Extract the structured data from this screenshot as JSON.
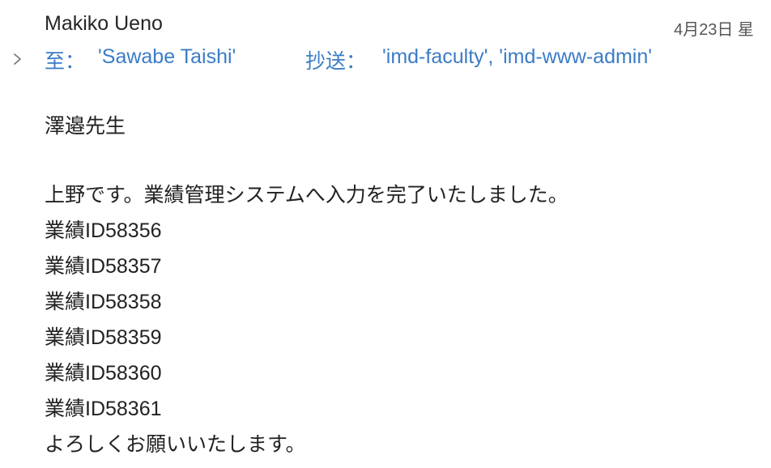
{
  "header": {
    "sender": "Makiko Ueno",
    "date": "4月23日 星",
    "expand_icon": "chevron-right-icon",
    "to_label": "至：",
    "to_value": "'Sawabe Taishi'",
    "cc_label": "抄送：",
    "cc_value": "'imd-faculty', 'imd-www-admin'",
    "link_color": "#3b7cc6"
  },
  "body": {
    "greeting": "澤邉先生",
    "intro": "上野です。業績管理システムへ入力を完了いたしました。",
    "entries": [
      "業績ID58356",
      "業績ID58357",
      "業績ID58358",
      "業績ID58359",
      "業績ID58360",
      "業績ID58361"
    ],
    "closing": "よろしくお願いいたします。"
  }
}
